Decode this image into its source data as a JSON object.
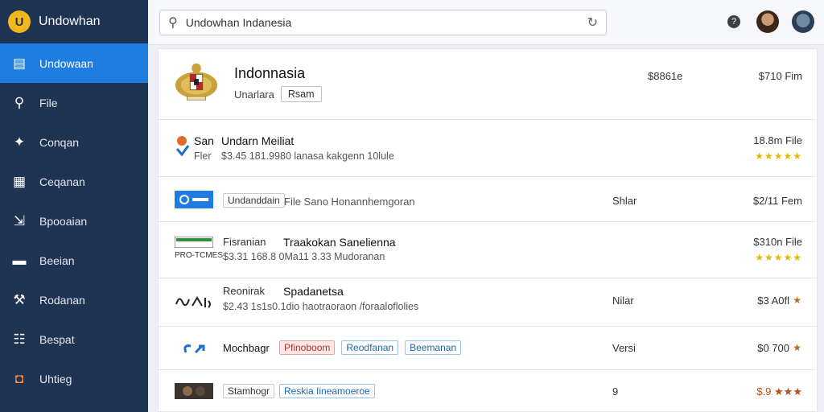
{
  "app": {
    "brand_initial": "U",
    "title": "Undowhan"
  },
  "sidebar": {
    "items": [
      {
        "label": "Undowaan",
        "icon": "document-icon",
        "glyph": "▤"
      },
      {
        "label": "File",
        "icon": "search-icon",
        "glyph": "⚲"
      },
      {
        "label": "Conqan",
        "icon": "puzzle-icon",
        "glyph": "✦"
      },
      {
        "label": "Ceqanan",
        "icon": "layout-icon",
        "glyph": "▦"
      },
      {
        "label": "Bpooaian",
        "icon": "export-icon",
        "glyph": "⇲"
      },
      {
        "label": "Beeian",
        "icon": "folder-icon",
        "glyph": "▬"
      },
      {
        "label": "Rodanan",
        "icon": "tools-icon",
        "glyph": "⚒"
      },
      {
        "label": "Bespat",
        "icon": "grid-icon",
        "glyph": "☷"
      },
      {
        "label": "Uhtieg",
        "icon": "app-icon",
        "glyph": "◘"
      }
    ]
  },
  "search": {
    "value": "Undowhan Indanesia",
    "placeholder": ""
  },
  "topbar": {
    "help_glyph": "?"
  },
  "hero": {
    "title": "Indonnasia",
    "subtitle": "Unarlara",
    "button": "Rsam",
    "mid": "$8861e",
    "price": "$710 Fim"
  },
  "rows": [
    {
      "name_a": "San",
      "name_b": "Undarn Meiliat",
      "sub_a": "Fler",
      "sub_b": "$3.45 181.9980 lanasa kakgenn 10lule",
      "price": "18.8m File",
      "stars": "★★★★★"
    },
    {
      "tag": "Undanddain",
      "link": "File Sano Honannhemgoran",
      "mid": "Shlar",
      "price": "$2/11 Fem"
    },
    {
      "thumb_text": "PRO-TCMES",
      "name_a": "Fisranian",
      "name_b": "Traakokan Sanelienna",
      "sub": "$3.31 168.8 0Ma11 3.33 Mudoranan",
      "price": "$310n File",
      "stars": "★★★★★"
    },
    {
      "name_a": "Reonirak",
      "name_b": "Spadanetsa",
      "sub": "$2.43 1s1s0.1dio haotraoraon /foraaloflolies",
      "mid": "Nilar",
      "price": "$3 A0fl",
      "stars": "★"
    },
    {
      "name": "Mochbagr",
      "tag1": "Pfinoboom",
      "tag2": "Reodfanan",
      "tag3": "Beemanan",
      "mid": "Versi",
      "price": "$0 700",
      "stars": "★"
    },
    {
      "name": "Stamhogr",
      "tag": "Reskia Iineamoeroe",
      "mid": "9",
      "price": "$.9 ★★★"
    }
  ]
}
